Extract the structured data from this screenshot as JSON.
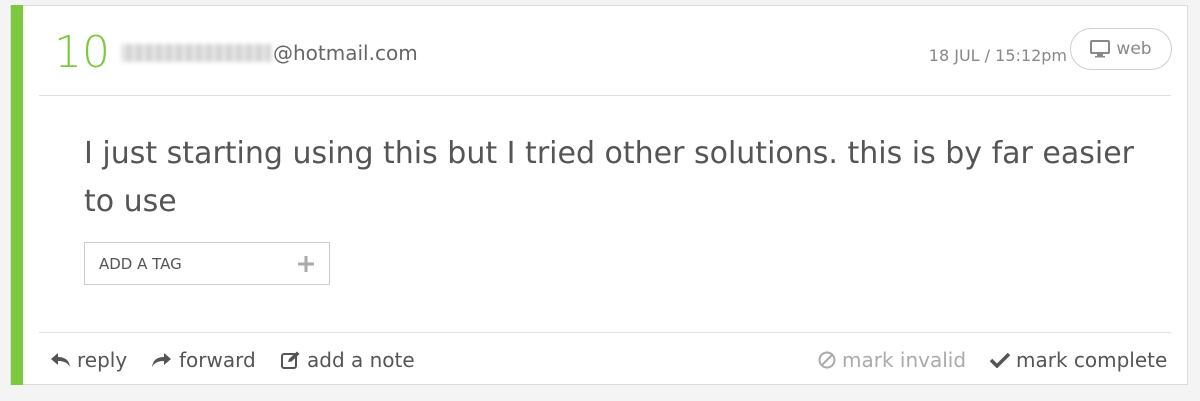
{
  "message_card": {
    "score": "10",
    "email_visible": "@hotmail.com",
    "timestamp": "18 JUL / 15:12pm",
    "source": {
      "label": "web",
      "icon": "monitor-icon"
    },
    "body": "I just starting using this but I tried other solutions. this is by far easier to use",
    "tag_input": {
      "placeholder": "ADD A TAG",
      "icon": "plus-icon"
    },
    "actions": {
      "reply": "reply",
      "forward": "forward",
      "add_note": "add a note",
      "mark_invalid": "mark invalid",
      "mark_complete": "mark complete"
    }
  },
  "colors": {
    "accent": "#7cc93c",
    "muted_text": "#aaaaaa"
  }
}
